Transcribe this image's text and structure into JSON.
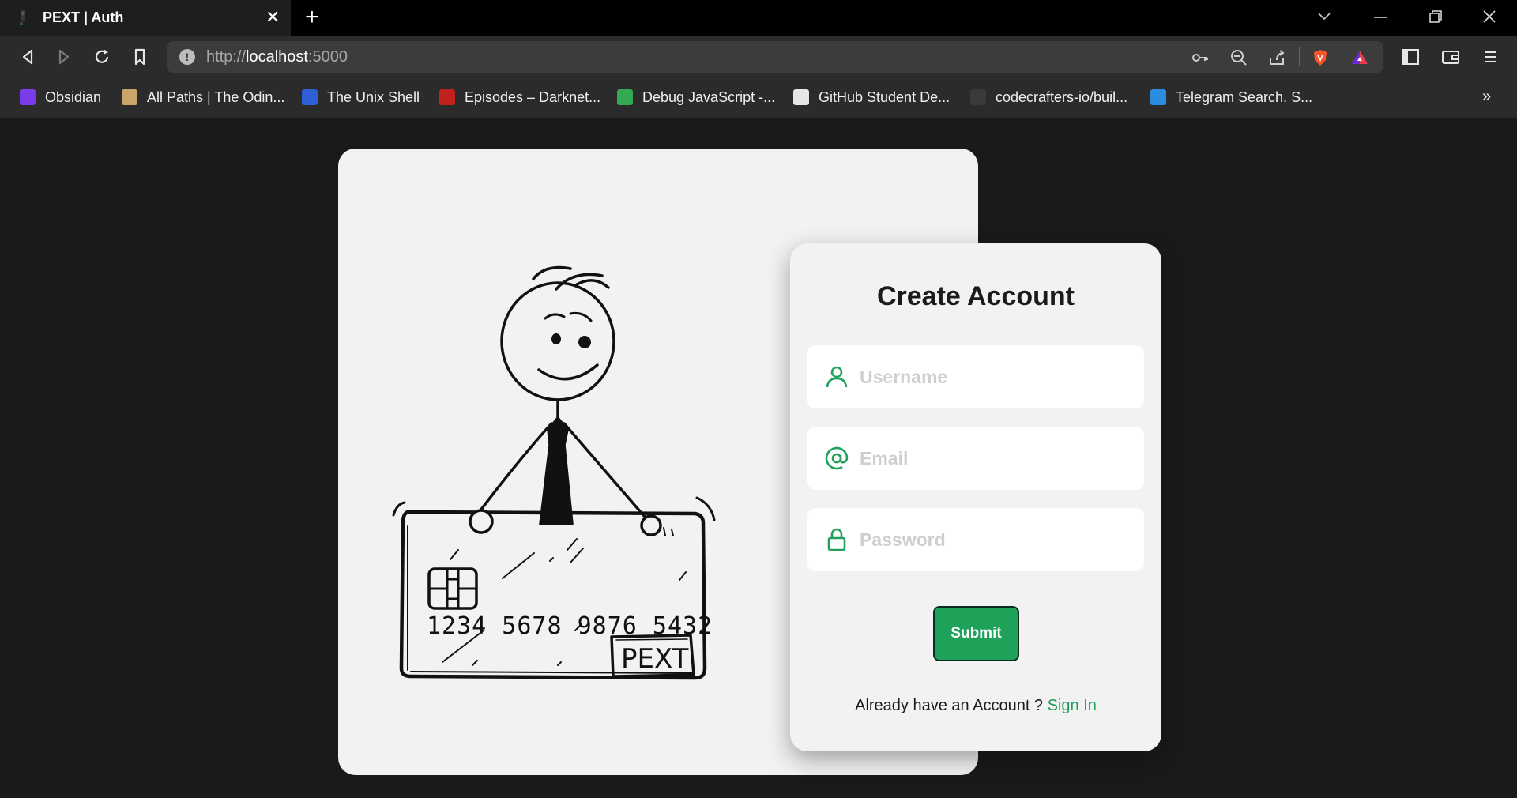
{
  "browser": {
    "tab_title": "PEXT | Auth",
    "new_tab_symbol": "+",
    "url_prefix": "http://",
    "url_host": "localhost",
    "url_suffix": ":5000",
    "bookmarks": [
      {
        "label": "Obsidian",
        "icon": "obsidian-icon",
        "color": "#7c3aed"
      },
      {
        "label": "All Paths | The Odin...",
        "icon": "odin-icon",
        "color": "#c9a46b"
      },
      {
        "label": "The Unix Shell",
        "icon": "unix-shell-icon",
        "color": "#2f5fd6"
      },
      {
        "label": "Episodes – Darknet...",
        "icon": "darknet-icon",
        "color": "#c21f1f"
      },
      {
        "label": "Debug JavaScript -...",
        "icon": "chrome-icon",
        "color": "#34a853"
      },
      {
        "label": "GitHub Student De...",
        "icon": "github-icon",
        "color": "#e6e6e6"
      },
      {
        "label": "codecrafters-io/buil...",
        "icon": "codecrafters-icon",
        "color": "#3a3a3a"
      },
      {
        "label": "Telegram Search. S...",
        "icon": "telegram-search-icon",
        "color": "#2a8de0"
      }
    ],
    "more_bookmarks": "»"
  },
  "illustration": {
    "card_number": "1234 5678 9876 5432",
    "card_brand": "PEXT"
  },
  "form": {
    "title": "Create Account",
    "username_placeholder": "Username",
    "email_placeholder": "Email",
    "password_placeholder": "Password",
    "submit_label": "Submit",
    "signin_prompt": "Already have an Account ? ",
    "signin_link": "Sign In",
    "accent_color": "#1ea25a"
  }
}
